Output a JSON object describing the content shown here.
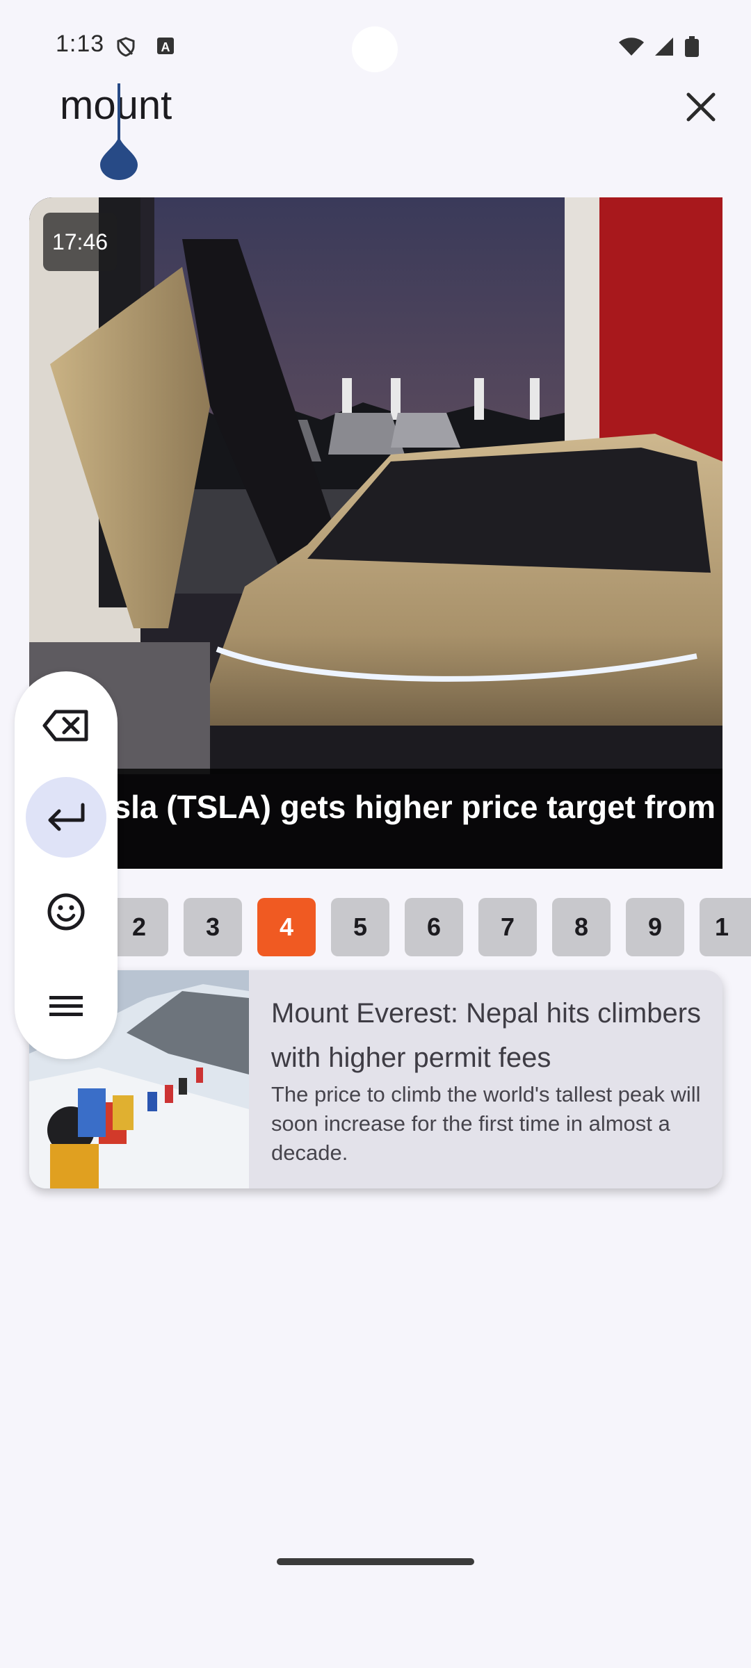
{
  "status_bar": {
    "time": "1:13",
    "icons": [
      "shield-icon",
      "a-icon",
      "wifi-icon",
      "signal-icon",
      "battery-icon"
    ]
  },
  "search": {
    "query": "mount",
    "close_icon": "close-icon"
  },
  "hero": {
    "time_badge": "17:46",
    "headline": "Tesla (TSLA) gets higher price target from"
  },
  "pager": {
    "pages": [
      "2",
      "3",
      "4",
      "5",
      "6",
      "7",
      "8",
      "9",
      "1"
    ],
    "active": "4",
    "active_color": "#f05a22"
  },
  "news": {
    "title": "Mount Everest: Nepal hits climbers with higher permit fees",
    "description": "The price to climb the world's tallest peak will soon increase for the first time in almost a decade."
  },
  "keyboard_toolbar": {
    "buttons": [
      "backspace-icon",
      "enter-icon",
      "emoji-icon",
      "menu-icon"
    ]
  }
}
